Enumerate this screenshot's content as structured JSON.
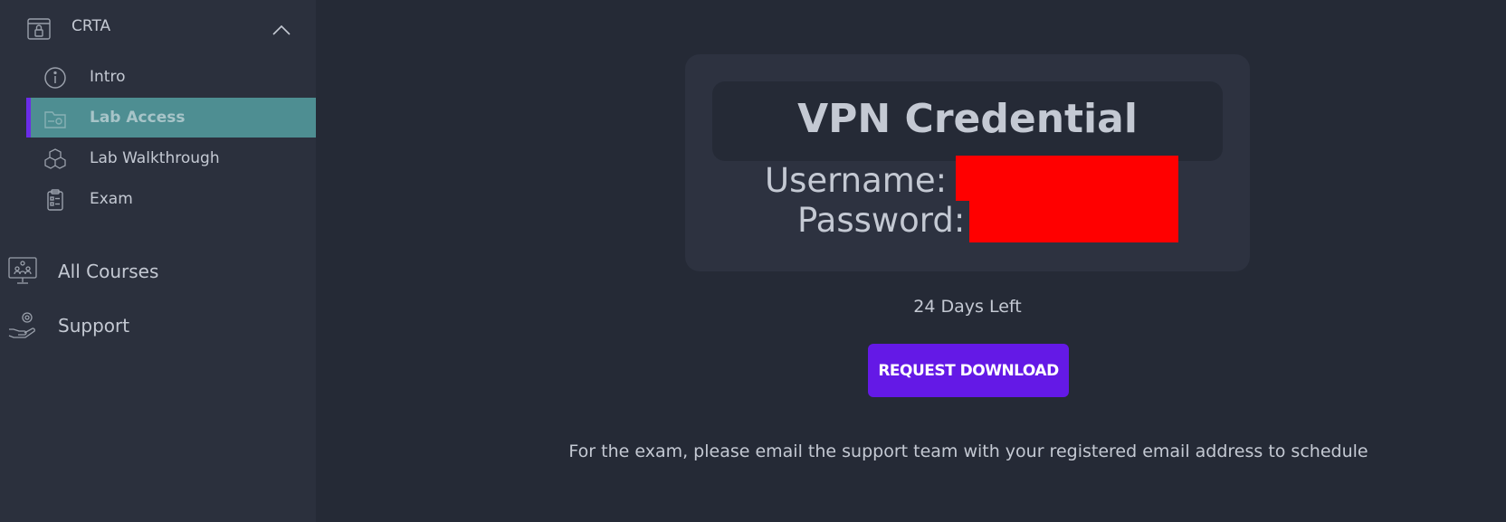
{
  "sidebar": {
    "course": {
      "label": "CRTA",
      "icon": "lock-certificate-icon",
      "expanded_icon": "chevron-up-icon"
    },
    "sub_items": [
      {
        "label": "Intro",
        "icon": "info-icon",
        "active": false
      },
      {
        "label": "Lab Access",
        "icon": "folder-gear-icon",
        "active": true
      },
      {
        "label": "Lab Walkthrough",
        "icon": "cubes-icon",
        "active": false
      },
      {
        "label": "Exam",
        "icon": "clipboard-checklist-icon",
        "active": false
      }
    ],
    "main_items": [
      {
        "label": "All Courses",
        "icon": "monitor-courses-icon"
      },
      {
        "label": "Support",
        "icon": "hand-gear-icon"
      }
    ]
  },
  "main": {
    "card_title": "VPN Credential",
    "username_label": "Username:",
    "password_label": "Password:",
    "days_left": "24 Days Left",
    "request_button": "REQUEST DOWNLOAD",
    "exam_note": "For the exam, please email the support team with your registered email address to schedule"
  },
  "colors": {
    "background": "#252a36",
    "sidebar": "#2b303d",
    "active_item": "#4e8e92",
    "accent": "#6419e6",
    "redaction": "#ff0000"
  }
}
